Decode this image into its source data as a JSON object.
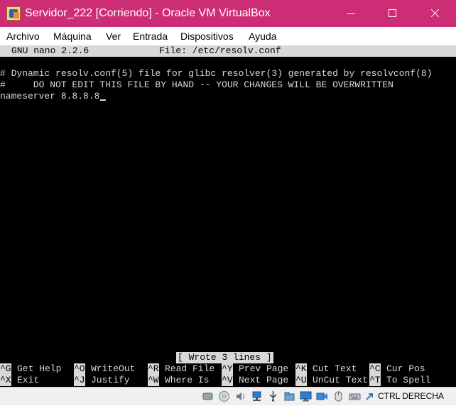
{
  "window": {
    "title": "Servidor_222 [Corriendo] - Oracle VM VirtualBox"
  },
  "menu": [
    "Archivo",
    "Máquina",
    "Ver",
    "Entrada",
    "Dispositivos",
    "Ayuda"
  ],
  "nano": {
    "version": "GNU nano 2.2.6",
    "file": "File: /etc/resolv.conf",
    "lines": [
      "# Dynamic resolv.conf(5) file for glibc resolver(3) generated by resolvconf(8)",
      "#     DO NOT EDIT THIS FILE BY HAND -- YOUR CHANGES WILL BE OVERWRITTEN",
      "nameserver 8.8.8.8"
    ],
    "status": "[ Wrote 3 lines ]",
    "shortcuts": [
      {
        "key": "^G",
        "label": "Get Help"
      },
      {
        "key": "^O",
        "label": "WriteOut"
      },
      {
        "key": "^R",
        "label": "Read File"
      },
      {
        "key": "^Y",
        "label": "Prev Page"
      },
      {
        "key": "^K",
        "label": "Cut Text"
      },
      {
        "key": "^C",
        "label": "Cur Pos"
      },
      {
        "key": "^X",
        "label": "Exit"
      },
      {
        "key": "^J",
        "label": "Justify"
      },
      {
        "key": "^W",
        "label": "Where Is"
      },
      {
        "key": "^V",
        "label": "Next Page"
      },
      {
        "key": "^U",
        "label": "UnCut Text"
      },
      {
        "key": "^T",
        "label": "To Spell"
      }
    ]
  },
  "statusbar": {
    "host_key": "CTRL DERECHA",
    "icons": [
      "hard-disk-icon",
      "optical-drive-icon",
      "audio-icon",
      "network-icon",
      "usb-icon",
      "shared-folders-icon",
      "display-icon",
      "video-capture-icon",
      "mouse-integration-icon",
      "keyboard-icon",
      "host-key-arrow-icon"
    ]
  },
  "colors": {
    "titlebar": "#cc2d74",
    "terminal_bg": "#000000",
    "terminal_fg": "#d8d8d8"
  }
}
